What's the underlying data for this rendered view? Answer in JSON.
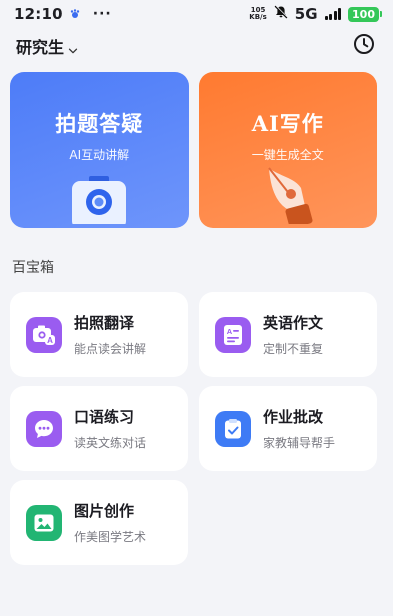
{
  "status_bar": {
    "time": "12:10",
    "more": "···",
    "netspeed_value": "105",
    "netspeed_unit": "KB/s",
    "network": "5G",
    "battery": "100",
    "battery_color": "#34c759"
  },
  "header": {
    "grade": "研究生",
    "history_icon": "clock-icon"
  },
  "hero": [
    {
      "title": "拍题答疑",
      "subtitle": "AI互动讲解",
      "color": "#5783f9",
      "icon": "camera-icon"
    },
    {
      "title": "AI写作",
      "subtitle": "一键生成全文",
      "color": "#ff8240",
      "icon": "pen-nib-icon"
    }
  ],
  "section": {
    "title": "百宝箱"
  },
  "tools": [
    {
      "title": "拍照翻译",
      "subtitle": "能点读会讲解",
      "icon": "camera-translate-icon",
      "color": "#9a5cf0"
    },
    {
      "title": "英语作文",
      "subtitle": "定制不重复",
      "icon": "essay-icon",
      "color": "#9a5cf0"
    },
    {
      "title": "口语练习",
      "subtitle": "读英文练对话",
      "icon": "chat-bubble-icon",
      "color": "#9a5cf0"
    },
    {
      "title": "作业批改",
      "subtitle": "家教辅导帮手",
      "icon": "homework-check-icon",
      "color": "#3e7bf5"
    },
    {
      "title": "图片创作",
      "subtitle": "作美图学艺术",
      "icon": "image-icon",
      "color": "#22b573"
    }
  ]
}
